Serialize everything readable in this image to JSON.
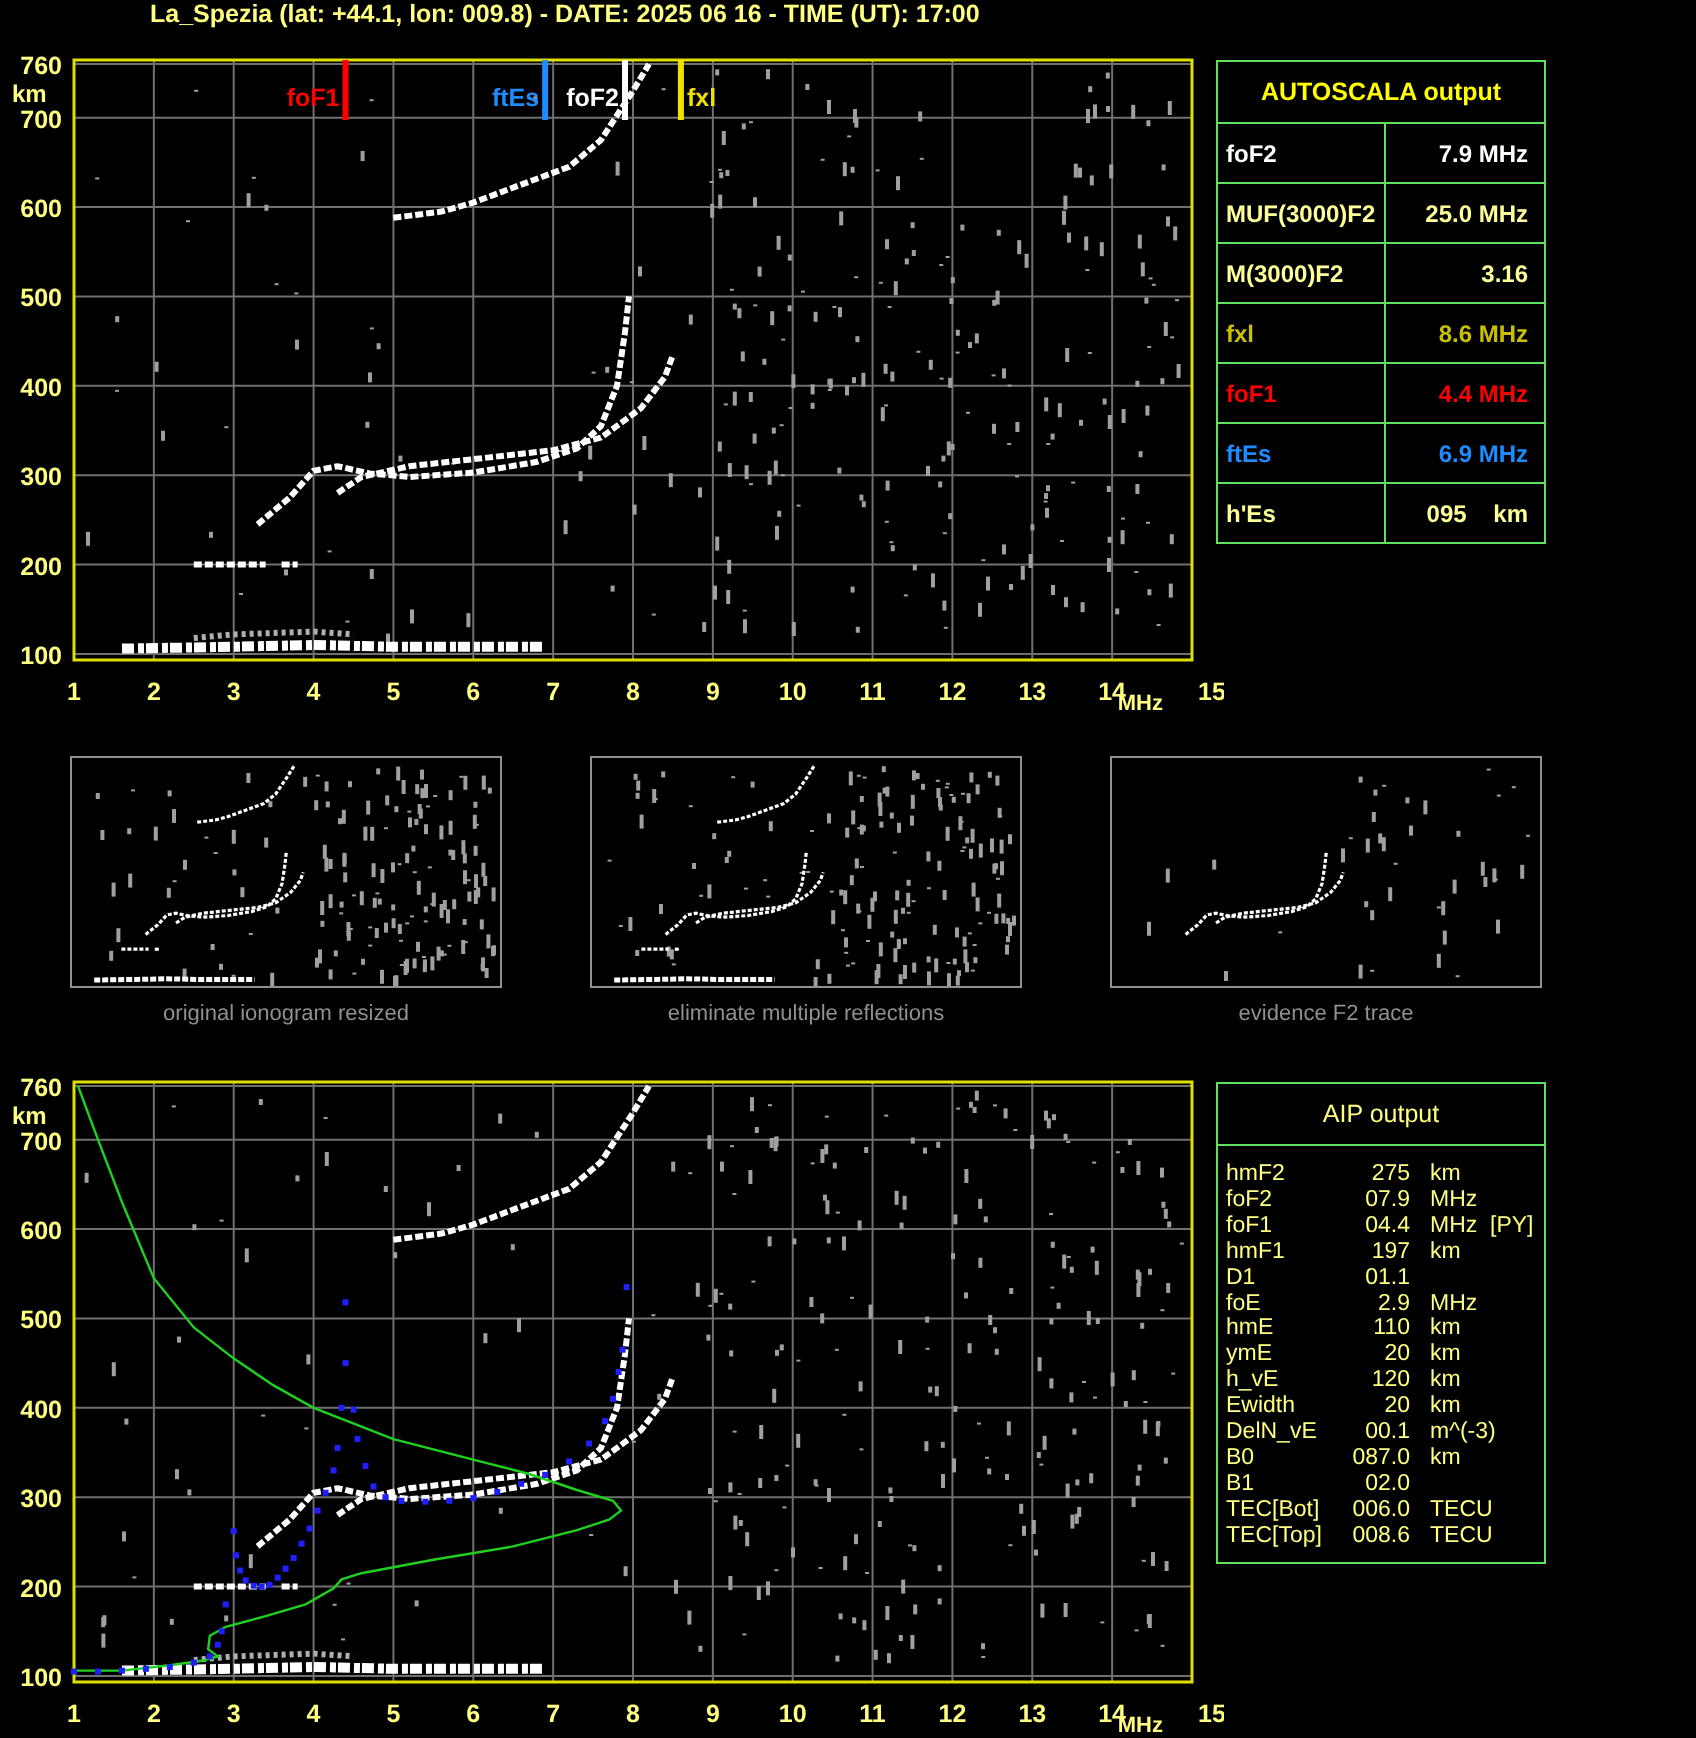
{
  "title": "La_Spezia (lat: +44.1, lon: 009.8) - DATE: 2025 06 16 - TIME (UT): 17:00",
  "top_ionogram": {
    "y_ticks": [
      "760",
      "700",
      "600",
      "500",
      "400",
      "300",
      "200",
      "100"
    ],
    "y_unit": "km",
    "x_ticks": [
      "1",
      "2",
      "3",
      "4",
      "5",
      "6",
      "7",
      "8",
      "9",
      "10",
      "11",
      "12",
      "13",
      "14",
      "15"
    ],
    "x_unit": "MHz",
    "markers": [
      {
        "label": "foF1",
        "color": "#ff0000"
      },
      {
        "label": "ftEs",
        "color": "#1e8cff"
      },
      {
        "label": "foF2",
        "color": "#ffffff"
      },
      {
        "label": "fxl",
        "color": "#f0e000"
      }
    ]
  },
  "autoscala": {
    "title": "AUTOSCALA output",
    "rows": [
      {
        "label": "foF2",
        "value": "7.9 MHz",
        "color": "#ffffff"
      },
      {
        "label": "MUF(3000)F2",
        "value": "25.0 MHz",
        "color": "#ffff99"
      },
      {
        "label": "M(3000)F2",
        "value": "3.16",
        "color": "#ffff99"
      },
      {
        "label": "fxl",
        "value": "8.6 MHz",
        "color": "#c8c000"
      },
      {
        "label": "foF1",
        "value": "4.4 MHz",
        "color": "#ff0000"
      },
      {
        "label": "ftEs",
        "value": "6.9 MHz",
        "color": "#1e8cff"
      },
      {
        "label": "h'Es",
        "value": "095    km",
        "color": "#ffff99"
      }
    ]
  },
  "thumbnails": [
    {
      "caption": "original ionogram resized"
    },
    {
      "caption": "eliminate multiple reflections"
    },
    {
      "caption": "evidence F2 trace"
    }
  ],
  "bottom_ionogram": {
    "y_ticks": [
      "760",
      "700",
      "600",
      "500",
      "400",
      "300",
      "200",
      "100"
    ],
    "y_unit": "km",
    "x_ticks": [
      "1",
      "2",
      "3",
      "4",
      "5",
      "6",
      "7",
      "8",
      "9",
      "10",
      "11",
      "12",
      "13",
      "14",
      "15"
    ],
    "x_unit": "MHz"
  },
  "aip": {
    "title": "AIP output",
    "rows": [
      [
        "hmF2",
        "275",
        "km"
      ],
      [
        "foF2",
        "07.9",
        "MHz"
      ],
      [
        "foF1",
        "04.4",
        "MHz",
        "[PY]"
      ],
      [
        "hmF1",
        "197",
        "km"
      ],
      [
        "D1",
        "01.1"
      ],
      [
        "foE",
        "2.9",
        "MHz"
      ],
      [
        "hmE",
        "110",
        "km"
      ],
      [
        "ymE",
        "20",
        "km"
      ],
      [
        "h_vE",
        "120",
        "km"
      ],
      [
        "Ewidth",
        "20",
        "km"
      ],
      [
        "DelN_vE",
        "00.1",
        "m^(-3)"
      ],
      [
        "B0",
        "087.0",
        "km"
      ],
      [
        "B1",
        "02.0"
      ],
      [
        "TEC[Bot]",
        "006.0",
        "TECU"
      ],
      [
        "TEC[Top]",
        "008.6",
        "TECU"
      ]
    ]
  }
}
